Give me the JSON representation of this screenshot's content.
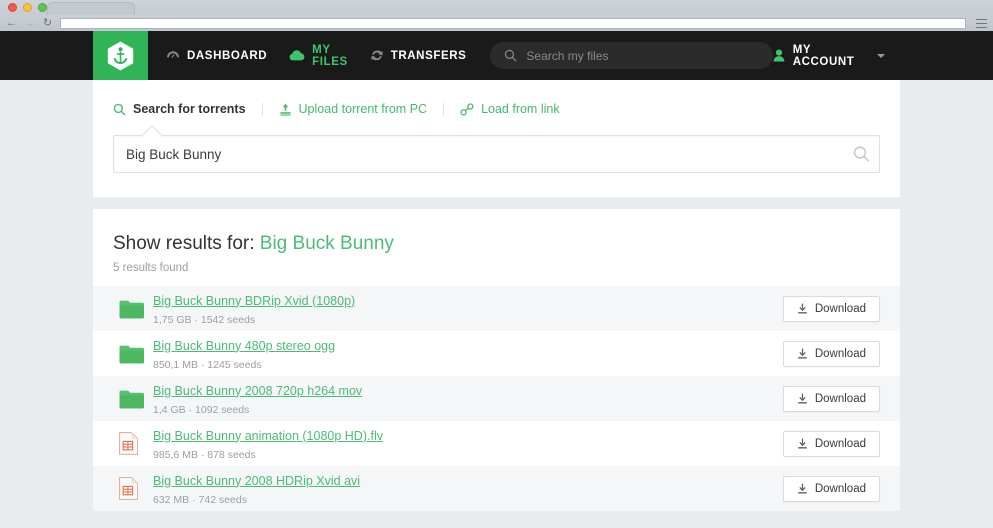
{
  "browser": {
    "back_icon": "back-arrow-icon",
    "forward_icon": "forward-arrow-icon",
    "reload_icon": "reload-icon",
    "url_value": "",
    "menu_icon": "hamburger-menu-icon"
  },
  "topnav": {
    "logo_icon": "anchor-logo-icon",
    "links": [
      {
        "label": "DASHBOARD",
        "icon": "dashboard-icon",
        "active": false
      },
      {
        "label": "MY FILES",
        "icon": "cloud-icon",
        "active": true
      },
      {
        "label": "TRANSFERS",
        "icon": "sync-icon",
        "active": false
      }
    ],
    "search": {
      "icon": "search-icon",
      "placeholder": "Search my files",
      "value": ""
    },
    "account": {
      "icon": "user-icon",
      "label": "MY ACCOUNT",
      "caret": "chevron-down-icon"
    }
  },
  "search_panel": {
    "tabs": [
      {
        "label": "Search for torrents",
        "icon": "search-icon",
        "active": true
      },
      {
        "label": "Upload torrent from PC",
        "icon": "upload-icon",
        "active": false
      },
      {
        "label": "Load from link",
        "icon": "link-icon",
        "active": false
      }
    ],
    "input": {
      "value": "Big Buck Bunny",
      "placeholder": "Search for torrents"
    },
    "submit_icon": "search-icon"
  },
  "results": {
    "title_prefix": "Show results for: ",
    "query": "Big Buck Bunny",
    "count_text": "5 results found",
    "download_label": "Download",
    "download_icon": "download-icon",
    "items": [
      {
        "title": "Big Buck Bunny BDRip Xvid (1080p)",
        "meta": "1,75 GB · 1542 seeds",
        "icon": "folder-icon"
      },
      {
        "title": "Big Buck Bunny 480p stereo ogg",
        "meta": "850,1 MB · 1245 seeds",
        "icon": "folder-icon"
      },
      {
        "title": "Big Buck Bunny 2008 720p h264 mov",
        "meta": "1,4 GB · 1092 seeds",
        "icon": "folder-icon"
      },
      {
        "title": "Big Buck Bunny animation (1080p HD).flv",
        "meta": "985,6 MB · 878 seeds",
        "icon": "video-file-icon"
      },
      {
        "title": "Big Buck Bunny 2008 HDRip Xvid avi",
        "meta": "632 MB · 742 seeds",
        "icon": "video-file-icon"
      }
    ]
  },
  "colors": {
    "brand_green": "#2fb457",
    "link_green": "#4cbb77",
    "nav_black": "#1a1a1a",
    "page_bg": "#e9ecef",
    "row_alt": "#f5f6f8"
  }
}
